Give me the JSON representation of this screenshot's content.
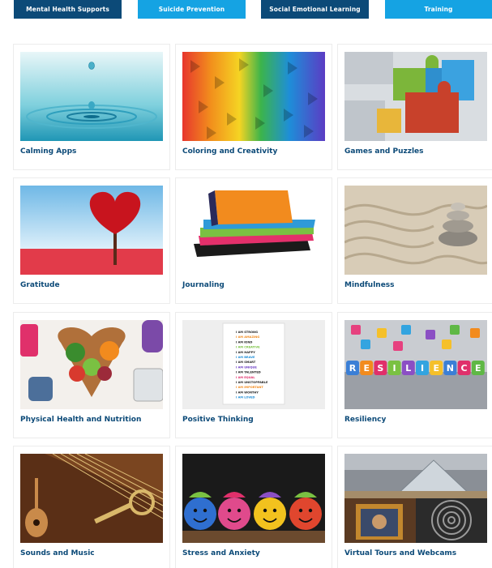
{
  "nav": {
    "tabs": [
      {
        "label": "Mental Health Supports"
      },
      {
        "label": "Suicide Prevention"
      },
      {
        "label": "Social Emotional Learning"
      },
      {
        "label": "Training"
      }
    ]
  },
  "cards": [
    {
      "title": "Calming Apps"
    },
    {
      "title": "Coloring and Creativity"
    },
    {
      "title": "Games and Puzzles"
    },
    {
      "title": "Gratitude"
    },
    {
      "title": "Journaling"
    },
    {
      "title": "Mindfulness"
    },
    {
      "title": "Physical Health and Nutrition"
    },
    {
      "title": "Positive Thinking"
    },
    {
      "title": "Resiliency"
    },
    {
      "title": "Sounds and Music"
    },
    {
      "title": "Stress and Anxiety"
    },
    {
      "title": "Virtual Tours and Webcams"
    }
  ],
  "posters": {
    "positive_thinking_lines": [
      "I AM STRONG",
      "I AM AMAZING",
      "I AM KIND",
      "I AM CREATIVE",
      "I AM HAPPY",
      "I AM BRAVE",
      "I AM SMART",
      "I AM UNIQUE",
      "I AM TALENTED",
      "I AM EQUAL",
      "I AM UNSTOPPABLE",
      "I AM IMPORTANT",
      "I AM WORTHY",
      "I AM LOVED"
    ],
    "resilience_letters": [
      "R",
      "E",
      "S",
      "I",
      "L",
      "I",
      "E",
      "N",
      "C",
      "E"
    ]
  },
  "colors": {
    "tab_dark": "#0c4a78",
    "tab_light": "#15a3e3",
    "card_title": "#0c4a78"
  }
}
